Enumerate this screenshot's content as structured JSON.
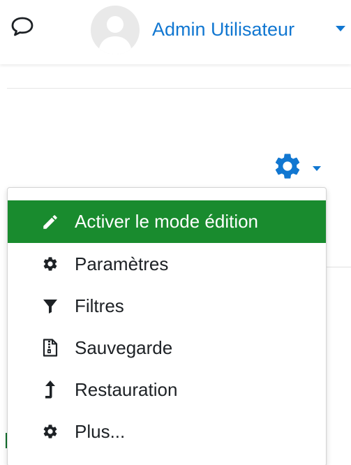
{
  "header": {
    "message_icon": "speech-bubble-icon",
    "user": {
      "name": "Admin Utilisateur",
      "avatar_icon": "default-avatar-icon"
    }
  },
  "actions": {
    "gear_icon": "gear-icon"
  },
  "menu": {
    "items": [
      {
        "label": "Activer le mode édition",
        "icon": "pencil-icon",
        "active": true
      },
      {
        "label": "Paramètres",
        "icon": "gear-icon",
        "active": false
      },
      {
        "label": "Filtres",
        "icon": "filter-icon",
        "active": false
      },
      {
        "label": "Sauvegarde",
        "icon": "file-archive-icon",
        "active": false
      },
      {
        "label": "Restauration",
        "icon": "arrow-up-icon",
        "active": false
      },
      {
        "label": "Plus...",
        "icon": "gear-icon",
        "active": false
      }
    ]
  },
  "colors": {
    "accent": "#1177d1",
    "active_bg": "#198b2e",
    "text": "#1d2125"
  }
}
